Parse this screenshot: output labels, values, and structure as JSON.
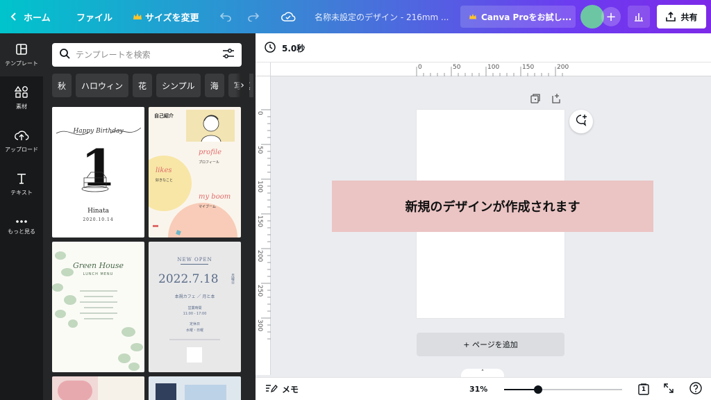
{
  "topbar": {
    "home_label": "ホーム",
    "file_label": "ファイル",
    "resize_label": "サイズを変更",
    "doc_title": "名称未設定のデザイン - 216mm ...",
    "pro_label": "Canva Proをお試し...",
    "share_label": "共有"
  },
  "rail": {
    "items": [
      {
        "label": "テンプレート",
        "icon": "template-icon"
      },
      {
        "label": "素材",
        "icon": "elements-icon"
      },
      {
        "label": "アップロード",
        "icon": "upload-icon"
      },
      {
        "label": "テキスト",
        "icon": "text-icon"
      },
      {
        "label": "もっと見る",
        "icon": "more-icon"
      }
    ]
  },
  "panel": {
    "search_placeholder": "テンプレートを検索",
    "chips": [
      "秋",
      "ハロウィン",
      "花",
      "シンプル",
      "海",
      "写真"
    ],
    "templates": [
      {
        "title": "Happy Birthday",
        "number": "1",
        "name": "Hinata",
        "date": "2020.10.14"
      },
      {
        "headline": "自己紹介",
        "profile": "profile",
        "profile_jp": "プロフィール",
        "likes": "likes",
        "likes_jp": "好きなこと",
        "boom": "my boom",
        "boom_jp": "マイブーム"
      },
      {
        "title": "Green House",
        "subtitle": "LUNCH MENU"
      },
      {
        "badge": "NEW OPEN",
        "date": "2022.7.18",
        "dow": "月曜日",
        "cafe": "本規カフェ ／ 月と本",
        "hours_label": "営業時間",
        "hours": "11:00 - 17:00",
        "holiday_label": "定休日",
        "holiday": "水曜・日曜"
      }
    ]
  },
  "canvas": {
    "duration": "5.0秒",
    "banner_text": "新規のデザインが作成されます",
    "add_page_label": "+ ページを追加",
    "ruler_top": [
      "0",
      "50",
      "100",
      "150",
      "200"
    ],
    "ruler_left": [
      "0",
      "50",
      "100",
      "150",
      "200",
      "250",
      "300"
    ]
  },
  "bottombar": {
    "memo_label": "メモ",
    "zoom": "31%",
    "zoom_fraction": 0.29,
    "page_number": "1"
  }
}
